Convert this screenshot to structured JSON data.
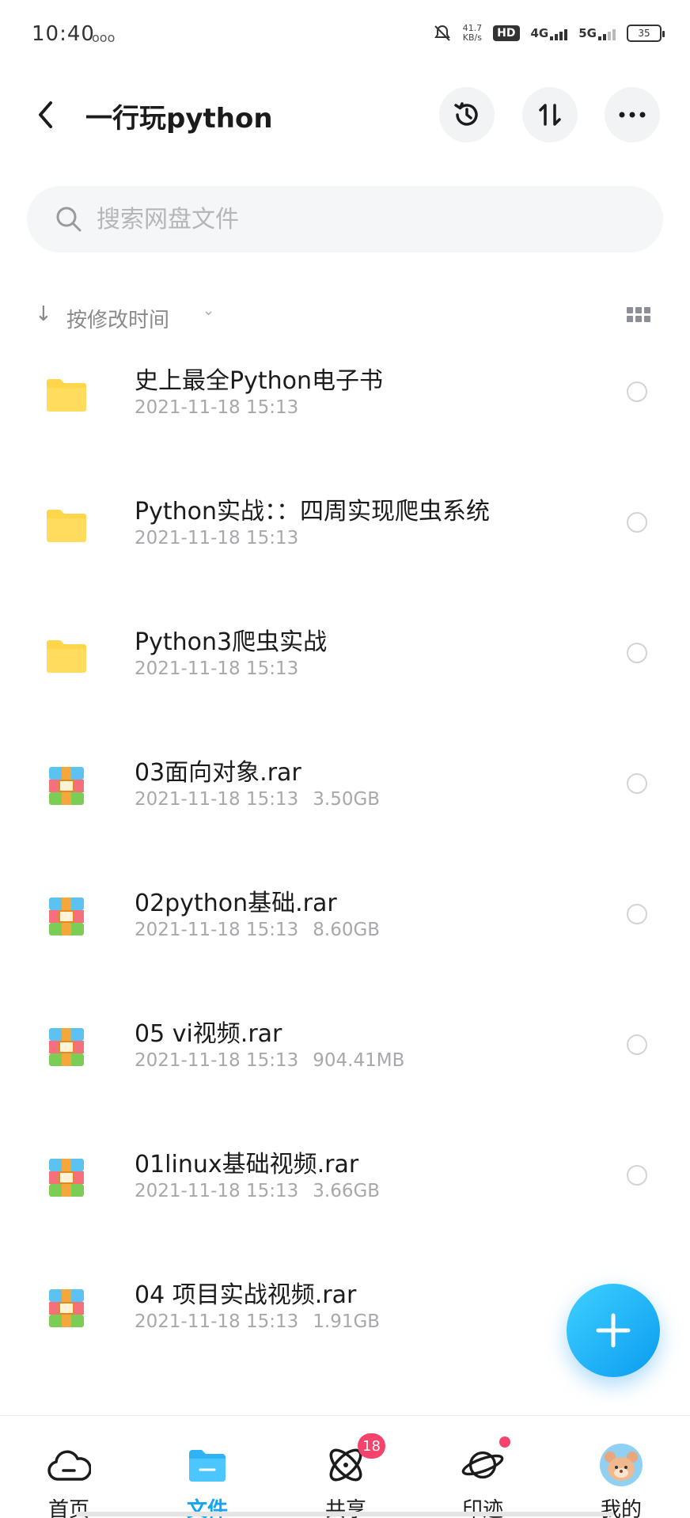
{
  "status_bar": {
    "time": "10:40",
    "ring_icon": "ooo",
    "speed": "41.7",
    "speed_unit": "KB/s",
    "hd": "HD",
    "net1": "4G",
    "net2": "5G",
    "battery": "35"
  },
  "header": {
    "title": "一行玩python",
    "icons": [
      "back-arrow-icon",
      "history-icon",
      "sort-icon",
      "more-icon"
    ]
  },
  "search": {
    "placeholder": "搜索网盘文件"
  },
  "sort": {
    "label": "按修改时间",
    "arrow": "↓",
    "chevron": "⌄"
  },
  "files": [
    {
      "name": "史上最全Python电子书",
      "date": "2021-11-18 15:13",
      "size": "",
      "type": "folder"
    },
    {
      "name": "Python实战：：四周实现爬虫系统",
      "date": "2021-11-18 15:13",
      "size": "",
      "type": "folder"
    },
    {
      "name": "Python3爬虫实战",
      "date": "2021-11-18 15:13",
      "size": "",
      "type": "folder"
    },
    {
      "name": "03面向对象.rar",
      "date": "2021-11-18 15:13",
      "size": "3.50GB",
      "type": "rar"
    },
    {
      "name": "02python基础.rar",
      "date": "2021-11-18 15:13",
      "size": "8.60GB",
      "type": "rar"
    },
    {
      "name": "05 vi视频.rar",
      "date": "2021-11-18 15:13",
      "size": "904.41MB",
      "type": "rar"
    },
    {
      "name": "01linux基础视频.rar",
      "date": "2021-11-18 15:13",
      "size": "3.66GB",
      "type": "rar"
    },
    {
      "name": "04 项目实战视频.rar",
      "date": "2021-11-18 15:13",
      "size": "1.91GB",
      "type": "rar"
    }
  ],
  "nav": {
    "items": [
      {
        "label": "首页",
        "icon": "cloud-home-icon"
      },
      {
        "label": "文件",
        "icon": "folder-icon",
        "active": true
      },
      {
        "label": "共享",
        "icon": "atom-share-icon",
        "badge": "18"
      },
      {
        "label": "印迹",
        "icon": "planet-icon",
        "dot": true
      },
      {
        "label": "我的",
        "icon": "avatar-icon"
      }
    ]
  },
  "colors": {
    "accent": "#14a4f2",
    "folder": "#ffd54a",
    "badge": "#f5436b"
  }
}
